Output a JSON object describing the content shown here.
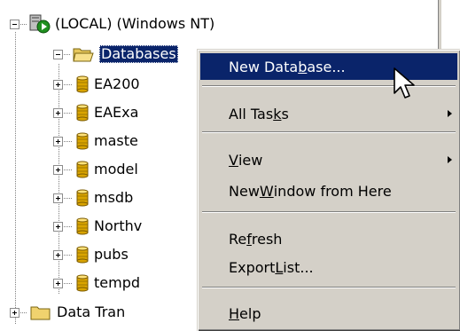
{
  "tree": {
    "server": {
      "label": "(LOCAL) (Windows NT)",
      "icon": "sql-server-running-icon"
    },
    "databases_folder": {
      "label": "Databases",
      "icon": "folder-open-icon"
    },
    "databases": [
      {
        "label": "EA200",
        "icon": "database-icon"
      },
      {
        "label": "EAExa",
        "icon": "database-icon"
      },
      {
        "label": "maste",
        "icon": "database-icon"
      },
      {
        "label": "model",
        "icon": "database-icon"
      },
      {
        "label": "msdb",
        "icon": "database-icon"
      },
      {
        "label": "Northv",
        "icon": "database-icon"
      },
      {
        "label": "pubs",
        "icon": "database-icon"
      },
      {
        "label": "tempd",
        "icon": "database-icon"
      }
    ],
    "data_transformation_folder": {
      "label": "Data Tran",
      "icon": "folder-icon"
    }
  },
  "context_menu": {
    "new_database": {
      "pre": "New Data",
      "key": "b",
      "post": "ase..."
    },
    "all_tasks": {
      "pre": "All Tas",
      "key": "k",
      "post": "s"
    },
    "view": {
      "pre": "",
      "key": "V",
      "post": "iew"
    },
    "new_window": {
      "pre": "New ",
      "key": "W",
      "post": "indow from Here"
    },
    "refresh": {
      "pre": "Re",
      "key": "f",
      "post": "resh"
    },
    "export_list": {
      "pre": "Export ",
      "key": "L",
      "post": "ist..."
    },
    "help": {
      "pre": "",
      "key": "H",
      "post": "elp"
    }
  },
  "colors": {
    "highlight": "#0a246a",
    "menu_bg": "#d4d0c8",
    "database_gold": "#d9a400"
  }
}
